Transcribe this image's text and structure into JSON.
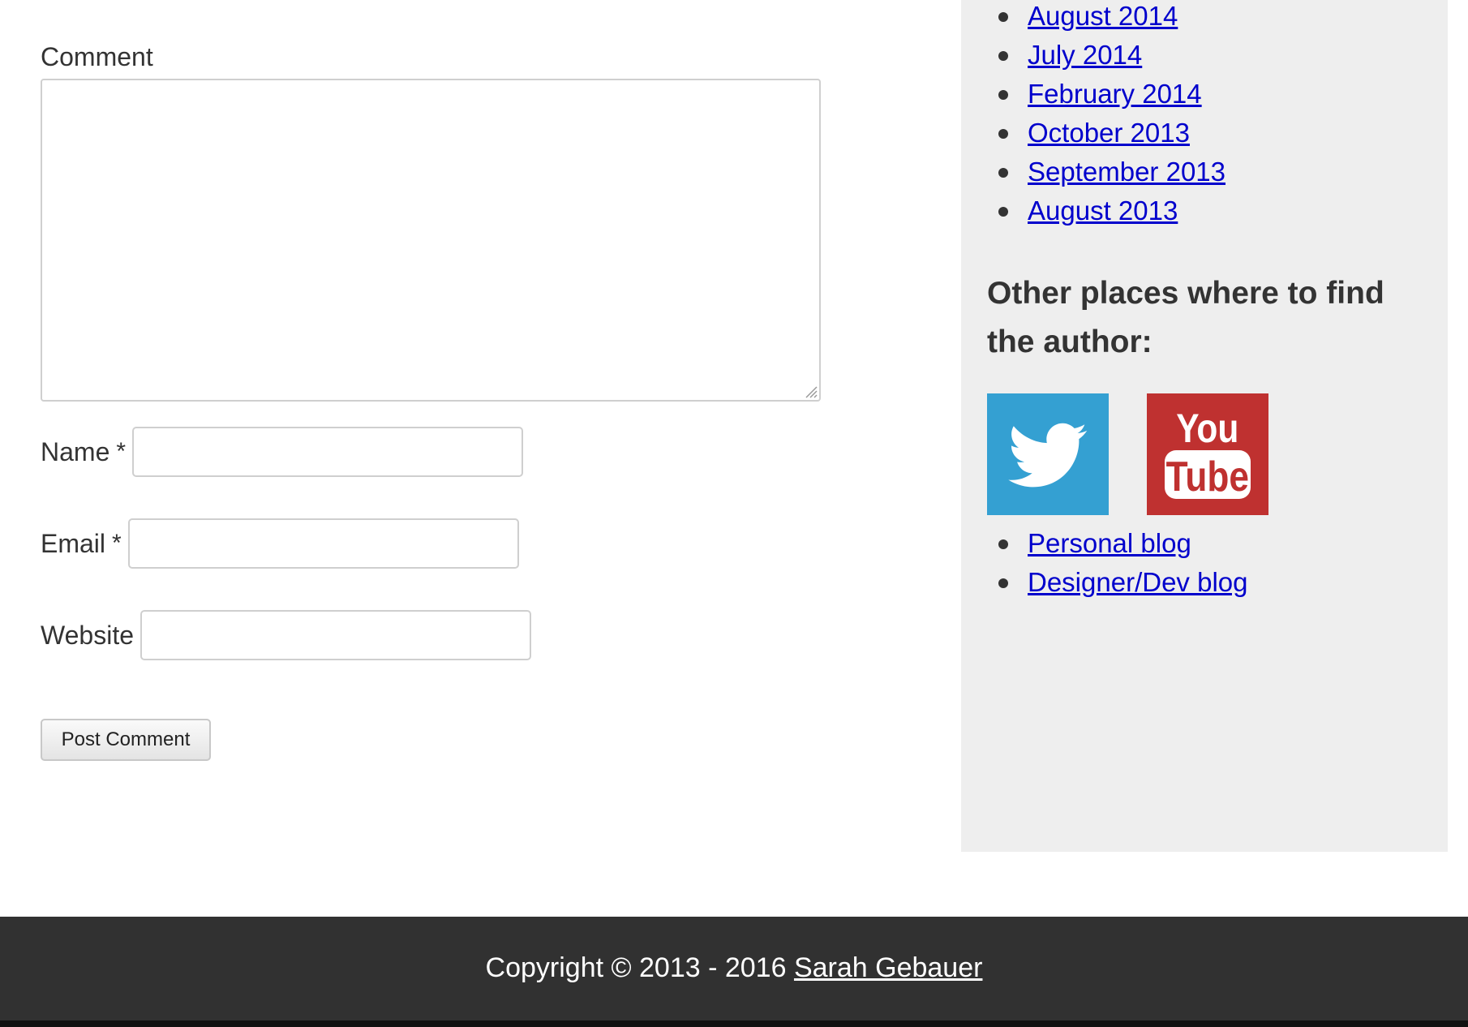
{
  "comment_form": {
    "comment_label": "Comment",
    "comment_value": "",
    "name_label": "Name",
    "email_label": "Email",
    "website_label": "Website",
    "required_mark": "*",
    "name_value": "",
    "email_value": "",
    "website_value": "",
    "submit_label": "Post Comment"
  },
  "sidebar": {
    "archives": [
      {
        "label": "August 2014"
      },
      {
        "label": "July 2014"
      },
      {
        "label": "February 2014"
      },
      {
        "label": "October 2013"
      },
      {
        "label": "September 2013"
      },
      {
        "label": "August 2013"
      }
    ],
    "heading": "Other places where to find the author:",
    "social_icons": [
      {
        "name": "twitter-icon",
        "color": "#34a0d2"
      },
      {
        "name": "youtube-icon",
        "color": "#bf3130",
        "text_top": "You",
        "text_bottom": "Tube"
      }
    ],
    "links": [
      {
        "label": "Personal blog"
      },
      {
        "label": "Designer/Dev blog"
      }
    ]
  },
  "footer": {
    "copyright": "Copyright © 2013 - 2016 ",
    "author": "Sarah Gebauer"
  },
  "colors": {
    "link": "#0000cc",
    "sidebar_bg": "#eeeeee",
    "footer_bg": "#313131",
    "text": "#333333"
  }
}
